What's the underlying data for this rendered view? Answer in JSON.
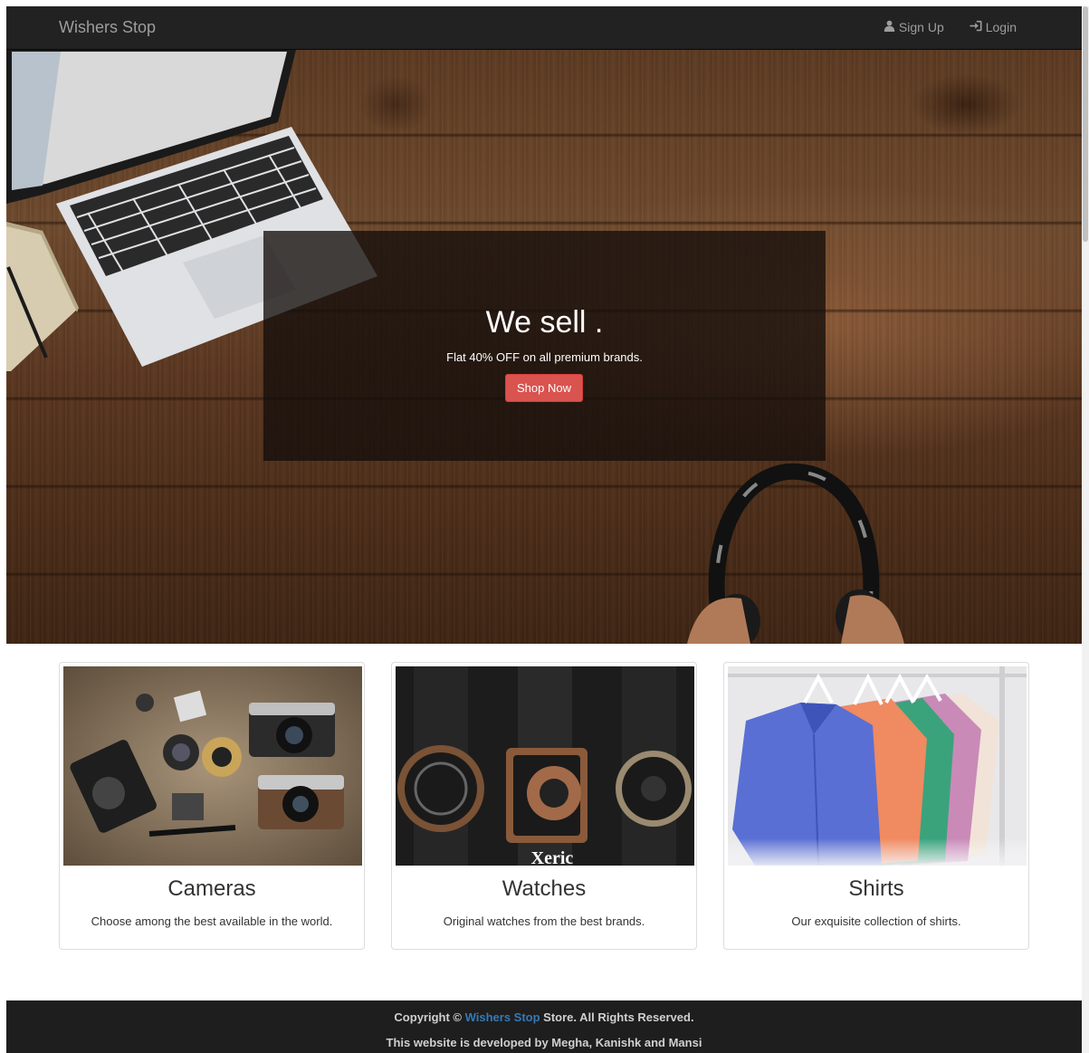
{
  "navbar": {
    "brand": "Wishers Stop",
    "signup_label": "Sign Up",
    "login_label": "Login"
  },
  "hero": {
    "title": "We sell .",
    "subtitle": "Flat 40% OFF on all premium brands.",
    "cta_label": "Shop Now"
  },
  "cards": [
    {
      "title": "Cameras",
      "description": "Choose among the best available in the world.",
      "image_label": ""
    },
    {
      "title": "Watches",
      "description": "Original watches from the best brands.",
      "image_label": "Xeric"
    },
    {
      "title": "Shirts",
      "description": "Our exquisite collection of shirts.",
      "image_label": ""
    }
  ],
  "footer": {
    "copyright_prefix": "Copyright © ",
    "copyright_brand": "Wishers Stop",
    "copyright_suffix": " Store. All Rights Reserved.",
    "developers": "This website is developed by Megha, Kanishk and Mansi"
  },
  "colors": {
    "navbar_bg": "#222222",
    "primary_button": "#d9534f",
    "link": "#337ab7",
    "footer_bg": "#1e1e1e"
  },
  "icons": [
    "user-icon",
    "login-icon"
  ]
}
